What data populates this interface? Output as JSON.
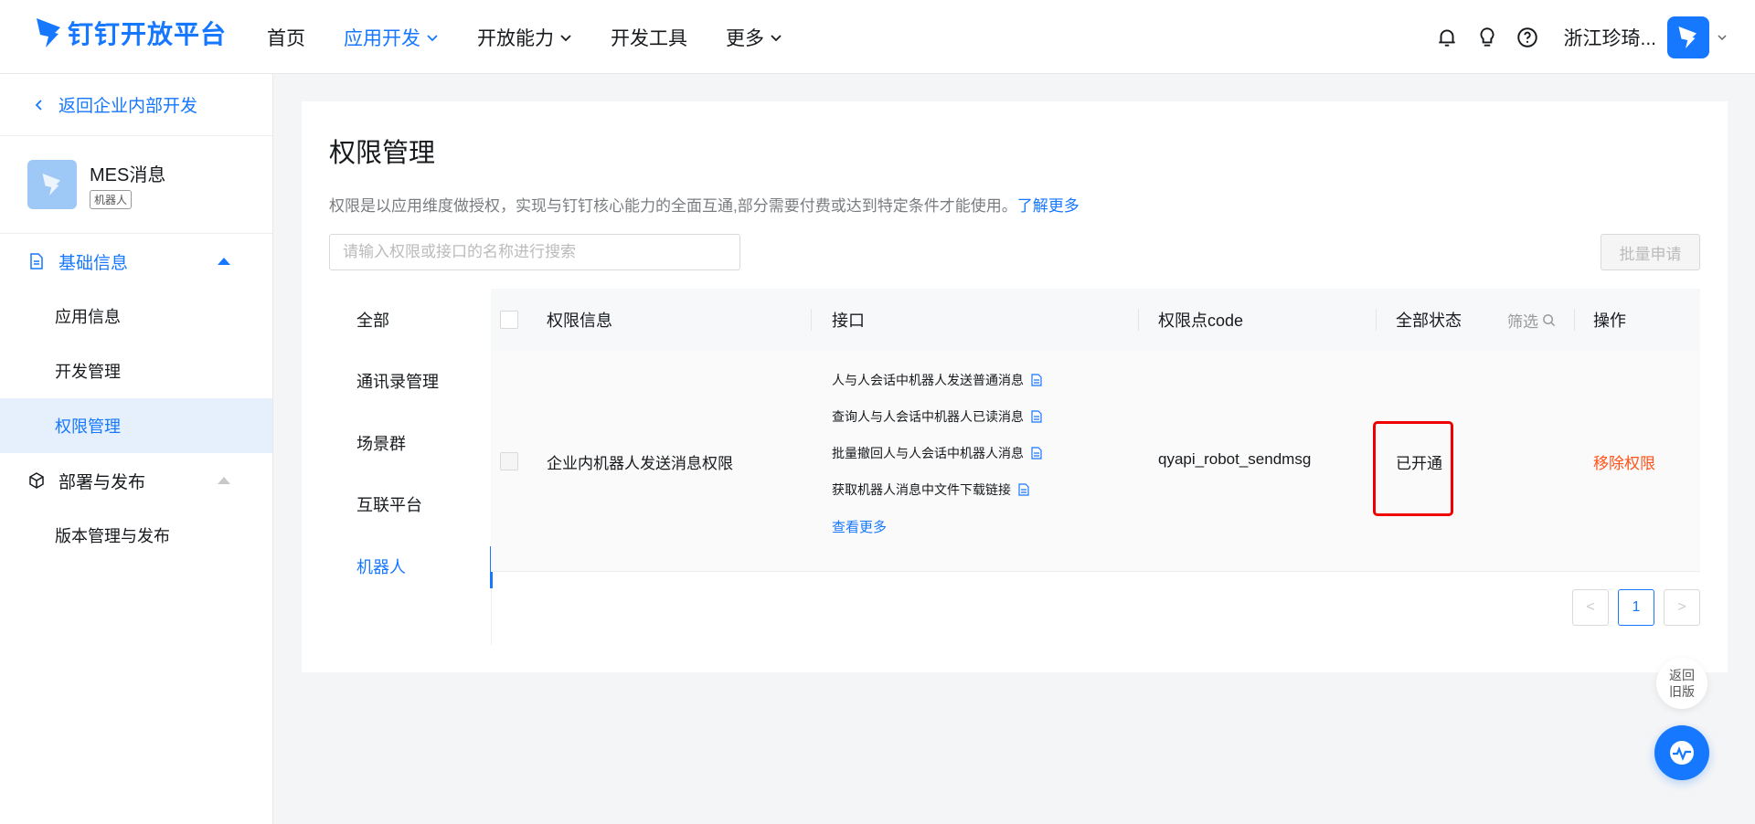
{
  "brand": {
    "name": "钉钉开放平台",
    "color": "#1677ff"
  },
  "nav": [
    {
      "label": "首页",
      "active": false,
      "dropdown": false
    },
    {
      "label": "应用开发",
      "active": true,
      "dropdown": true
    },
    {
      "label": "开放能力",
      "active": false,
      "dropdown": true
    },
    {
      "label": "开发工具",
      "active": false,
      "dropdown": false
    },
    {
      "label": "更多",
      "active": false,
      "dropdown": true
    }
  ],
  "header_right": {
    "icons": [
      "bell-icon",
      "lightbulb-icon",
      "help-icon"
    ],
    "user_name": "浙江珍琦..."
  },
  "sidebar": {
    "back_label": "返回企业内部开发",
    "app": {
      "name": "MES消息",
      "tag": "机器人"
    },
    "groups": [
      {
        "label": "基础信息",
        "icon": "document-icon",
        "expanded": true,
        "items": [
          "应用信息",
          "开发管理",
          "权限管理"
        ],
        "selected": "权限管理"
      },
      {
        "label": "部署与发布",
        "icon": "cube-icon",
        "expanded": true,
        "items": [
          "版本管理与发布"
        ]
      }
    ]
  },
  "page": {
    "title": "权限管理",
    "description": "权限是以应用维度做授权，实现与钉钉核心能力的全面互通,部分需要付费或达到特定条件才能使用。",
    "learn_more": "了解更多",
    "search_placeholder": "请输入权限或接口的名称进行搜索",
    "batch_button": "批量申请",
    "categories": [
      "全部",
      "通讯录管理",
      "场景群",
      "互联平台",
      "机器人"
    ],
    "active_category": "机器人"
  },
  "table": {
    "headers": {
      "permission": "权限信息",
      "api": "接口",
      "code": "权限点code",
      "status": "全部状态",
      "filter": "筛选",
      "action": "操作"
    },
    "rows": [
      {
        "permission": "企业内机器人发送消息权限",
        "apis": [
          "人与人会话中机器人发送普通消息",
          "查询人与人会话中机器人已读消息",
          "批量撤回人与人会话中机器人消息",
          "获取机器人消息中文件下载链接"
        ],
        "api_more": "查看更多",
        "code": "qyapi_robot_sendmsg",
        "status": "已开通",
        "action": "移除权限"
      }
    ]
  },
  "pagination": {
    "current": "1",
    "prev": "<",
    "next": ">"
  },
  "floating": {
    "old_version_line1": "返回",
    "old_version_line2": "旧版"
  }
}
